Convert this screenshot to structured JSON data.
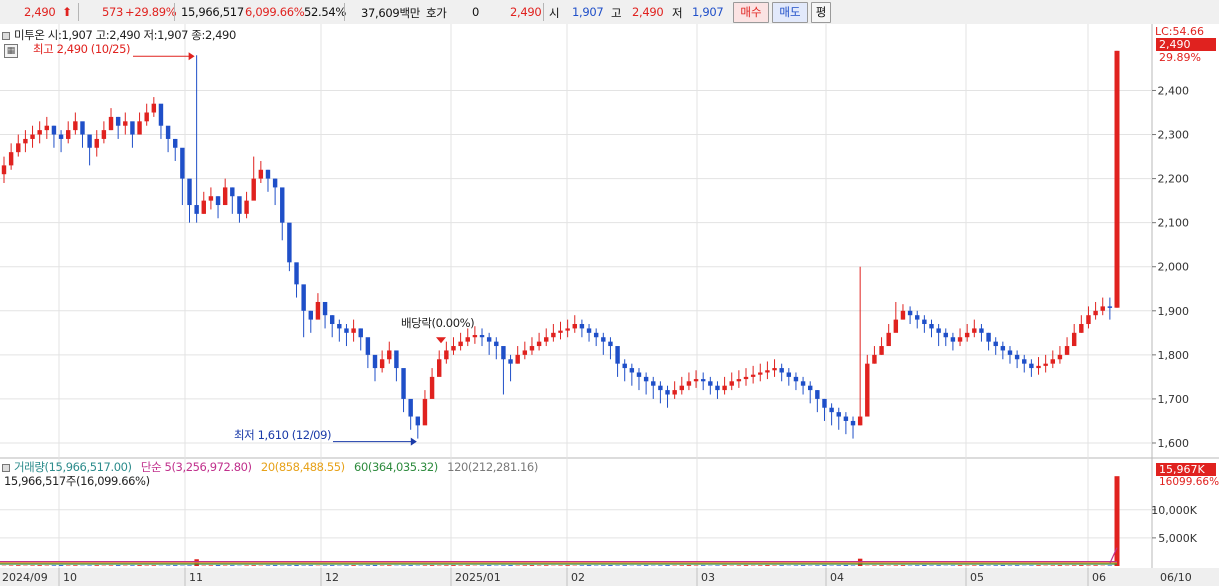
{
  "quote_bar": {
    "price": "2,490",
    "change": "573",
    "change_pct": "+29.89%",
    "volume": "15,966,517",
    "volume_ratio": "6,099.66%",
    "turnover_pct": "52.54%",
    "amount": "37,609백만",
    "hoga_label": "호가",
    "hoga_value": "0",
    "hoga_price": "2,490",
    "open_label": "시",
    "open_value": "1,907",
    "high_label": "고",
    "high_value": "2,490",
    "low_label": "저",
    "low_value": "1,907",
    "buy_label": "매수",
    "sell_label": "매도",
    "avg_label": "평"
  },
  "price_panel": {
    "stock_info": "미투온 시:1,907 고:2,490 저:1,907 종:2,490",
    "high_annotation": "최고 2,490 (10/25)",
    "low_annotation": "최저 1,610 (12/09)",
    "dividend_annotation": "배당락(0.00%)",
    "lc_label": "LC:54.66",
    "last_price_tag": "2,490",
    "last_pct_tag": "29.89%"
  },
  "volume_panel": {
    "legend_volume": "거래량(15,966,517.00)",
    "legend_ma5": "단순 5(3,256,972.80)",
    "legend_ma20": "20(858,488.55)",
    "legend_ma60": "60(364,035.32)",
    "legend_ma120": "120(212,281.16)",
    "info_line": "15,966,517주(16,099.66%)",
    "last_volume_tag": "15,967K",
    "last_volume_pct_tag": "16099.66%"
  },
  "colors": {
    "up": "#e0221f",
    "down": "#1f4fc8",
    "ma5": "#c0308c",
    "ma20": "#e7a21a",
    "ma60": "#2e8b3e",
    "ma120": "#7a7a7a"
  },
  "chart_data": [
    {
      "type": "candlestick",
      "title": "미투온",
      "x_labels": [
        "2024/09",
        "10",
        "11",
        "12",
        "2025/01",
        "02",
        "03",
        "04",
        "05",
        "06",
        "06/10"
      ],
      "ylim": [
        1575,
        2510
      ],
      "y_ticks": [
        1600,
        1700,
        1800,
        1900,
        2000,
        2100,
        2200,
        2300,
        2400
      ],
      "y_tick_labels": [
        "1,600",
        "1,700",
        "1,800",
        "1,900",
        "2,000",
        "2,100",
        "2,200",
        "2,300",
        "2,400"
      ],
      "grid": true,
      "close": [
        2230,
        2260,
        2280,
        2290,
        2300,
        2310,
        2320,
        2300,
        2290,
        2310,
        2330,
        2300,
        2270,
        2290,
        2310,
        2340,
        2320,
        2330,
        2300,
        2330,
        2350,
        2370,
        2320,
        2290,
        2270,
        2200,
        2140,
        2120,
        2150,
        2160,
        2140,
        2180,
        2160,
        2120,
        2150,
        2200,
        2220,
        2200,
        2180,
        2100,
        2010,
        1960,
        1900,
        1880,
        1920,
        1890,
        1870,
        1860,
        1850,
        1860,
        1840,
        1800,
        1770,
        1790,
        1810,
        1770,
        1700,
        1660,
        1640,
        1700,
        1750,
        1790,
        1810,
        1820,
        1830,
        1840,
        1845,
        1840,
        1830,
        1820,
        1790,
        1780,
        1800,
        1810,
        1820,
        1830,
        1840,
        1850,
        1855,
        1860,
        1870,
        1860,
        1850,
        1840,
        1830,
        1820,
        1780,
        1770,
        1760,
        1750,
        1740,
        1730,
        1720,
        1710,
        1720,
        1730,
        1740,
        1745,
        1740,
        1730,
        1720,
        1730,
        1740,
        1745,
        1750,
        1755,
        1760,
        1765,
        1770,
        1760,
        1750,
        1740,
        1730,
        1720,
        1700,
        1680,
        1670,
        1660,
        1650,
        1640,
        1660,
        1780,
        1800,
        1820,
        1850,
        1880,
        1900,
        1890,
        1880,
        1870,
        1860,
        1850,
        1840,
        1830,
        1840,
        1850,
        1860,
        1850,
        1830,
        1820,
        1810,
        1800,
        1790,
        1780,
        1770,
        1775,
        1780,
        1790,
        1800,
        1820,
        1850,
        1870,
        1890,
        1900,
        1910,
        1907,
        2490
      ],
      "high": [
        2250,
        2280,
        2300,
        2310,
        2320,
        2330,
        2340,
        2320,
        2310,
        2330,
        2350,
        2320,
        2290,
        2310,
        2330,
        2360,
        2340,
        2350,
        2320,
        2350,
        2370,
        2385,
        2340,
        2310,
        2290,
        2220,
        2160,
        2480,
        2170,
        2180,
        2160,
        2200,
        2180,
        2140,
        2170,
        2250,
        2240,
        2220,
        2200,
        2120,
        2030,
        1980,
        1920,
        1900,
        1940,
        1910,
        1890,
        1880,
        1870,
        1880,
        1860,
        1820,
        1790,
        1810,
        1830,
        1790,
        1720,
        1680,
        1660,
        1720,
        1770,
        1810,
        1830,
        1840,
        1850,
        1860,
        1865,
        1860,
        1850,
        1840,
        1810,
        1800,
        1820,
        1830,
        1840,
        1850,
        1860,
        1870,
        1875,
        1880,
        1890,
        1880,
        1870,
        1860,
        1850,
        1840,
        1800,
        1790,
        1780,
        1770,
        1760,
        1750,
        1740,
        1730,
        1740,
        1750,
        1760,
        1765,
        1760,
        1750,
        1740,
        1750,
        1760,
        1765,
        1770,
        1775,
        1780,
        1785,
        1790,
        1780,
        1770,
        1760,
        1750,
        1740,
        1720,
        1700,
        1690,
        1680,
        1670,
        1660,
        2000,
        1800,
        1820,
        1840,
        1870,
        1920,
        1915,
        1910,
        1900,
        1890,
        1880,
        1870,
        1860,
        1850,
        1860,
        1870,
        1880,
        1870,
        1850,
        1840,
        1830,
        1820,
        1810,
        1800,
        1790,
        1795,
        1800,
        1810,
        1820,
        1840,
        1870,
        1890,
        1910,
        1920,
        1930,
        1930,
        2490
      ],
      "low": [
        2190,
        2220,
        2250,
        2260,
        2270,
        2280,
        2290,
        2270,
        2260,
        2280,
        2300,
        2270,
        2230,
        2250,
        2280,
        2310,
        2290,
        2300,
        2270,
        2300,
        2320,
        2340,
        2290,
        2260,
        2240,
        2140,
        2100,
        2100,
        2120,
        2130,
        2110,
        2140,
        2120,
        2100,
        2110,
        2170,
        2190,
        2170,
        2140,
        2060,
        1990,
        1930,
        1840,
        1850,
        1890,
        1860,
        1840,
        1830,
        1820,
        1830,
        1810,
        1770,
        1740,
        1760,
        1780,
        1740,
        1670,
        1630,
        1610,
        1670,
        1720,
        1760,
        1780,
        1800,
        1810,
        1820,
        1825,
        1820,
        1800,
        1790,
        1710,
        1740,
        1780,
        1790,
        1800,
        1810,
        1820,
        1830,
        1835,
        1840,
        1850,
        1840,
        1830,
        1820,
        1800,
        1790,
        1750,
        1740,
        1730,
        1720,
        1710,
        1700,
        1690,
        1680,
        1700,
        1710,
        1720,
        1725,
        1720,
        1710,
        1700,
        1710,
        1720,
        1725,
        1730,
        1735,
        1740,
        1745,
        1750,
        1740,
        1730,
        1720,
        1710,
        1690,
        1670,
        1650,
        1640,
        1630,
        1620,
        1610,
        1640,
        1760,
        1780,
        1800,
        1830,
        1860,
        1880,
        1870,
        1860,
        1850,
        1840,
        1820,
        1820,
        1810,
        1820,
        1830,
        1840,
        1830,
        1810,
        1800,
        1790,
        1780,
        1770,
        1760,
        1750,
        1755,
        1760,
        1770,
        1780,
        1800,
        1830,
        1850,
        1860,
        1880,
        1890,
        1880,
        1907
      ]
    },
    {
      "type": "bar",
      "title": "거래량",
      "y_ticks": [
        5000000,
        10000000
      ],
      "y_tick_labels": [
        "5,000K",
        "10,000K"
      ],
      "ylim": [
        0,
        16000000
      ],
      "spikes": [
        {
          "label": "10/25",
          "value": 1200000
        },
        {
          "label": "04",
          "value": 1300000
        },
        {
          "label": "06/10",
          "value": 15966517
        }
      ]
    }
  ]
}
